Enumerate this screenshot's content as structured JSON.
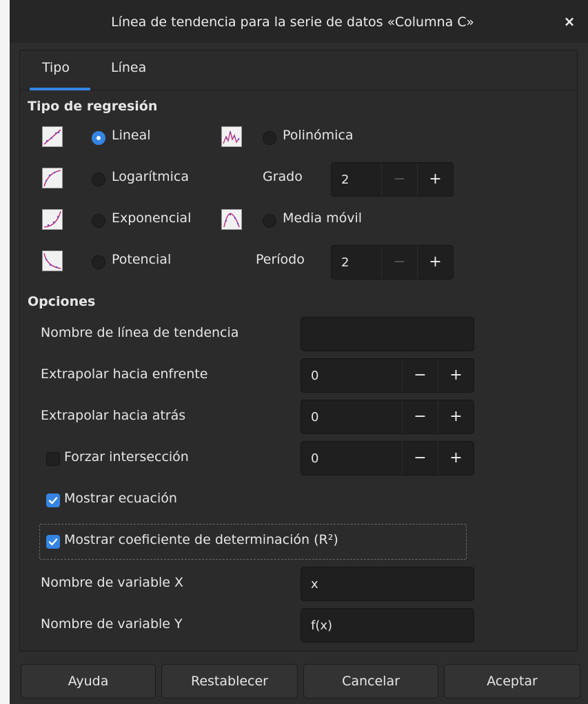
{
  "window": {
    "title": "Línea de tendencia para la serie de datos «Columna C»",
    "close_label": "×"
  },
  "tabs": [
    {
      "label": "Tipo",
      "active": true
    },
    {
      "label": "Línea",
      "active": false
    }
  ],
  "regression": {
    "header": "Tipo de regresión",
    "options": {
      "lineal": {
        "label": "Lineal",
        "selected": true,
        "icon": "linear-trend-icon"
      },
      "logaritmica": {
        "label": "Logarítmica",
        "selected": false,
        "icon": "logarithmic-trend-icon"
      },
      "exponencial": {
        "label": "Exponencial",
        "selected": false,
        "icon": "exponential-trend-icon"
      },
      "potencial": {
        "label": "Potencial",
        "selected": false,
        "icon": "power-trend-icon"
      },
      "polinomica": {
        "label": "Polinómica",
        "selected": false,
        "icon": "polynomial-trend-icon"
      },
      "media_movil": {
        "label": "Media móvil",
        "selected": false,
        "icon": "moving-average-trend-icon"
      }
    },
    "grado": {
      "label": "Grado",
      "value": "2",
      "minus": "−",
      "plus": "+"
    },
    "periodo": {
      "label": "Período",
      "value": "2",
      "minus": "−",
      "plus": "+"
    }
  },
  "options": {
    "header": "Opciones",
    "trendline_name": {
      "label": "Nombre de línea de tendencia",
      "value": ""
    },
    "extrapolate_forward": {
      "label": "Extrapolar hacia enfrente",
      "value": "0",
      "minus": "−",
      "plus": "+"
    },
    "extrapolate_backward": {
      "label": "Extrapolar hacia atrás",
      "value": "0",
      "minus": "−",
      "plus": "+"
    },
    "force_intercept": {
      "label": "Forzar intersección",
      "checked": false,
      "value": "0",
      "minus": "−",
      "plus": "+"
    },
    "show_equation": {
      "label": "Mostrar ecuación",
      "checked": true
    },
    "show_r2": {
      "label": "Mostrar coeficiente de determinación (R²)",
      "checked": true
    },
    "x_var": {
      "label": "Nombre de variable X",
      "value": "x"
    },
    "y_var": {
      "label": "Nombre de variable Y",
      "value": "f(x)"
    }
  },
  "buttons": {
    "help": "Ayuda",
    "reset": "Restablecer",
    "cancel": "Cancelar",
    "ok": "Aceptar"
  },
  "colors": {
    "accent": "#3584e4",
    "background": "#2d2d2d",
    "field": "#1f1f1f"
  }
}
